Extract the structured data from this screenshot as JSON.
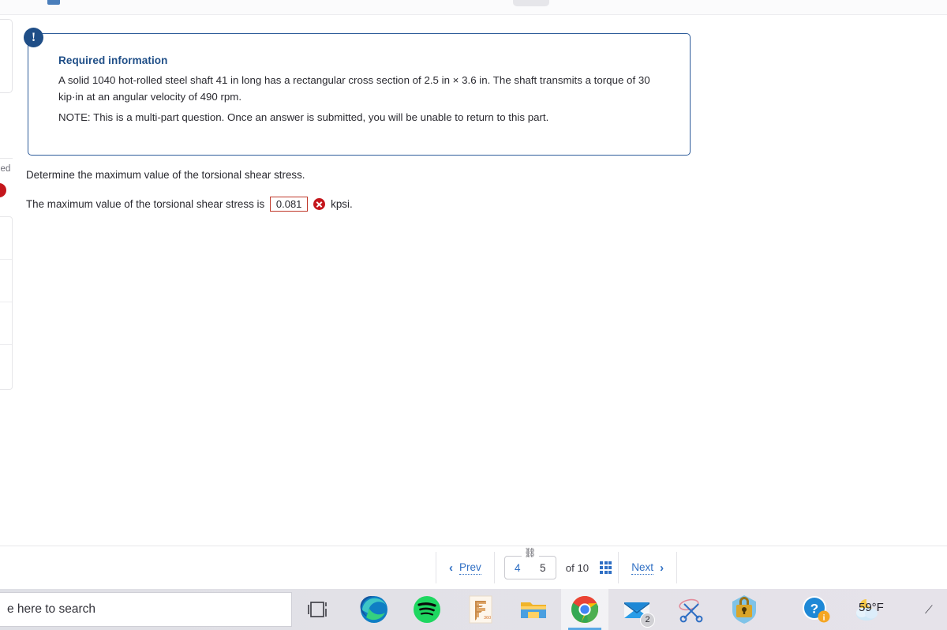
{
  "top_strip": {
    "tab_marker": "browser-tab-marker",
    "pill_marker": "toolbar-pill"
  },
  "left_panel": {
    "status_text": "led",
    "list_row_count": 4
  },
  "info_box": {
    "badge": "!",
    "title": "Required information",
    "body": "A solid 1040 hot-rolled steel shaft 41 in long has a rectangular cross section of 2.5 in × 3.6 in. The shaft transmits a torque of 30 kip·in at an angular velocity of 490 rpm.",
    "note": "NOTE: This is a multi-part question. Once an answer is submitted, you will be unable to return to this part.",
    "border_color": "#2e5c9a",
    "title_color": "#1f4e87"
  },
  "question": {
    "prompt": "Determine the maximum value of the torsional shear stress.",
    "answer_label": "The maximum value of the torsional shear stress is",
    "answer_value": "0.081",
    "answer_placeholder": "",
    "unit": "kpsi.",
    "status": "incorrect",
    "status_color": "#c4161c"
  },
  "footer_nav": {
    "prev_label": "Prev",
    "prev_chevron": "‹",
    "next_label": "Next",
    "next_chevron": "›",
    "link_icon": "⛓",
    "page_current": "4",
    "page_next": "5",
    "of_label": "of",
    "page_total": "10",
    "grid_icon": "grid-view-icon",
    "accent_color": "#2f6fc4"
  },
  "taskbar": {
    "search_placeholder": "e here to search",
    "icons": [
      {
        "name": "task-view-icon",
        "label": "Task View"
      },
      {
        "name": "microsoft-edge-icon",
        "label": "Microsoft Edge"
      },
      {
        "name": "spotify-icon",
        "label": "Spotify"
      },
      {
        "name": "fusion360-icon",
        "label": "Fusion 360"
      },
      {
        "name": "file-explorer-icon",
        "label": "File Explorer"
      },
      {
        "name": "google-chrome-icon",
        "label": "Google Chrome"
      },
      {
        "name": "mail-icon",
        "label": "Mail"
      },
      {
        "name": "snipping-tool-icon",
        "label": "Snipping Tool"
      },
      {
        "name": "security-lock-icon",
        "label": "Security"
      },
      {
        "name": "help-icon",
        "label": "Help"
      },
      {
        "name": "weather-icon",
        "label": "Weather"
      }
    ],
    "mail_badge": "2",
    "temperature": "59°F",
    "tray_arrow": "⟋"
  }
}
